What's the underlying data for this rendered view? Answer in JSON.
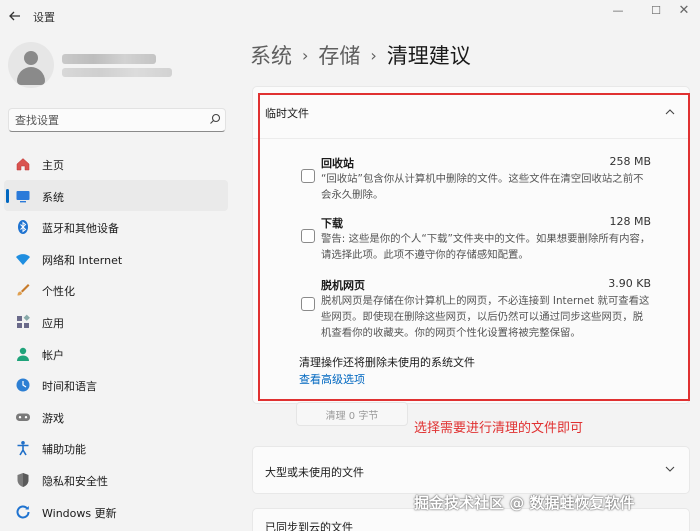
{
  "window": {
    "title": "设置",
    "controls": {
      "minimize": "—",
      "maximize": "☐",
      "close": "✕"
    }
  },
  "search": {
    "placeholder": "查找设置"
  },
  "nav": [
    {
      "label": "主页",
      "icon": "home-icon",
      "active": false
    },
    {
      "label": "系统",
      "icon": "system-icon",
      "active": true
    },
    {
      "label": "蓝牙和其他设备",
      "icon": "bluetooth-icon",
      "active": false
    },
    {
      "label": "网络和 Internet",
      "icon": "network-icon",
      "active": false
    },
    {
      "label": "个性化",
      "icon": "brush-icon",
      "active": false
    },
    {
      "label": "应用",
      "icon": "apps-icon",
      "active": false
    },
    {
      "label": "帐户",
      "icon": "account-icon",
      "active": false
    },
    {
      "label": "时间和语言",
      "icon": "time-language-icon",
      "active": false
    },
    {
      "label": "游戏",
      "icon": "gaming-icon",
      "active": false
    },
    {
      "label": "辅助功能",
      "icon": "accessibility-icon",
      "active": false
    },
    {
      "label": "隐私和安全性",
      "icon": "shield-icon",
      "active": false
    },
    {
      "label": "Windows 更新",
      "icon": "update-icon",
      "active": false
    }
  ],
  "breadcrumb": {
    "part1": "系统",
    "part2": "存储",
    "current": "清理建议",
    "sep": "›"
  },
  "temp_files": {
    "title": "临时文件",
    "items": [
      {
        "name": "回收站",
        "size": "258 MB",
        "desc": "“回收站”包含你从计算机中删除的文件。这些文件在清空回收站之前不会永久删除。"
      },
      {
        "name": "下载",
        "size": "128 MB",
        "desc": "警告: 这些是你的个人“下载”文件夹中的文件。如果想要删除所有内容，请选择此项。此项不遵守你的存储感知配置。"
      },
      {
        "name": "脱机网页",
        "size": "3.90 KB",
        "desc": "脱机网页是存储在你计算机上的网页，不必连接到 Internet 就可查看这些网页。即使现在删除这些网页，以后仍然可以通过同步这些网页，脱机查看你的收藏夹。你的网页个性化设置将被完整保留。"
      }
    ],
    "cleanup_note": "清理操作还将删除未使用的系统文件",
    "advanced_link": "查看高级选项",
    "clean_button": "清理 0 字节"
  },
  "annotation": {
    "text": "选择需要进行清理的文件即可",
    "color": "#e03131"
  },
  "large_files": {
    "title": "大型或未使用的文件"
  },
  "cloud_files": {
    "title": "已同步到云的文件"
  },
  "watermark": "掘金技术社区 @ 数据蛙恢复软件",
  "colors": {
    "accent": "#0067c0",
    "annotation": "#e03131",
    "background": "#f3f3f3"
  }
}
